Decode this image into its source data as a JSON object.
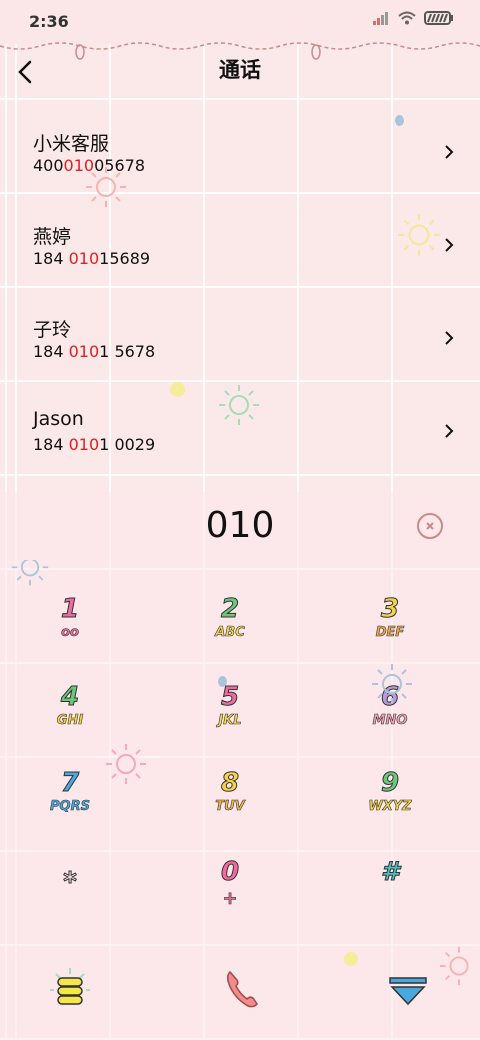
{
  "status": {
    "time": "2:36"
  },
  "header": {
    "title": "通话"
  },
  "contacts": [
    {
      "name": "小米客服",
      "num_pre": "400",
      "num_hl": "010",
      "num_post": "05678"
    },
    {
      "name": "燕婷",
      "num_pre": "184 ",
      "num_hl": "010",
      "num_post": "15689"
    },
    {
      "name": "子玲",
      "num_pre": "184 ",
      "num_hl": "010",
      "num_post": "1 5678"
    },
    {
      "name": "Jason",
      "num_pre": "184 ",
      "num_hl": "010",
      "num_post": "1 0029"
    }
  ],
  "dialer": {
    "input": "010"
  },
  "keys": [
    {
      "num": "1",
      "letters": "oo",
      "num_color": "#f06aa0",
      "let_color": "#f06aa0"
    },
    {
      "num": "2",
      "letters": "ABC",
      "num_color": "#6cc77a",
      "let_color": "#f2d85a"
    },
    {
      "num": "3",
      "letters": "DEF",
      "num_color": "#f4d24a",
      "let_color": "#f4a64a"
    },
    {
      "num": "4",
      "letters": "GHI",
      "num_color": "#6cc77a",
      "let_color": "#f4d24a"
    },
    {
      "num": "5",
      "letters": "JKL",
      "num_color": "#f06aa0",
      "let_color": "#f2d85a"
    },
    {
      "num": "6",
      "letters": "MNO",
      "num_color": "#b89ad8",
      "let_color": "#f4a0b4"
    },
    {
      "num": "7",
      "letters": "PQRS",
      "num_color": "#4aa8e0",
      "let_color": "#4aa8e0"
    },
    {
      "num": "8",
      "letters": "TUV",
      "num_color": "#f4d24a",
      "let_color": "#f4b44a"
    },
    {
      "num": "9",
      "letters": "WXYZ",
      "num_color": "#6cc77a",
      "let_color": "#f4d24a"
    },
    {
      "num": "*",
      "letters": "",
      "num_color": "#fbe6e8",
      "let_color": "#f4a0b4"
    },
    {
      "num": "0",
      "letters": "+",
      "num_color": "#f06aa0",
      "let_color": "#f06aa0"
    },
    {
      "num": "#",
      "letters": "",
      "num_color": "#4fc0c0",
      "let_color": "#4fc0c0"
    }
  ],
  "bottom": {
    "menu_icon": "menu-icon",
    "call_icon": "phone-icon",
    "collapse_icon": "collapse-icon"
  }
}
